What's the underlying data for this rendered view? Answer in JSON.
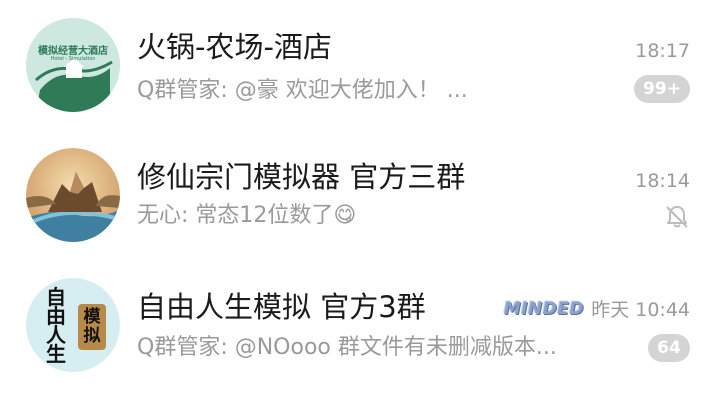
{
  "chats": [
    {
      "avatar_text": "模拟经营大酒店",
      "avatar_subtext": "Hotel - Simulation",
      "title": "火锅-农场-酒店",
      "time": "18:17",
      "preview": "Q群管家: @豪 欢迎大佬加入！ ...",
      "badge": "99+"
    },
    {
      "title": "修仙宗门模拟器 官方三群",
      "time": "18:14",
      "preview": "无心: 常态12位数了😋",
      "muted": true
    },
    {
      "avatar_text_left": "自由人生",
      "avatar_text_right": "模拟",
      "title": "自由人生模拟 官方3群",
      "tag": "MINDED",
      "time": "昨天 10:44",
      "preview": "Q群管家: @NOooo 群文件有未删减版本...",
      "badge": "64"
    }
  ],
  "colors": {
    "title": "#1b1b1b",
    "secondary": "#9a9a9a",
    "badge_bg": "#d4d4d4",
    "avatar1_bg": "#cde7e1",
    "avatar1_accent": "#2f7a57"
  },
  "icons": [
    "bell-muted-icon"
  ]
}
